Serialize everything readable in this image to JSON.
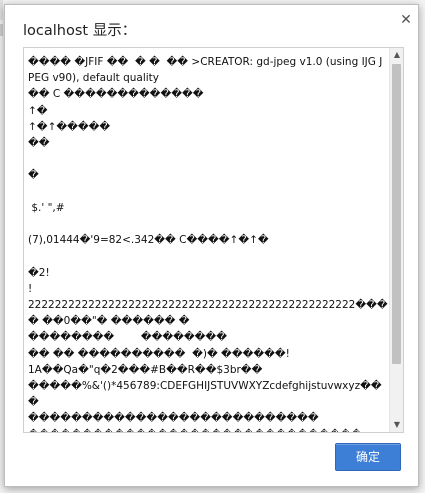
{
  "dialog": {
    "title": "localhost 显示：",
    "close_icon": "close-icon",
    "message": "���� �JFIF ��  � �  �� >CREATOR: gd-jpeg v1.0 (using IJG JPEG v90), default quality\n�� C �������������\n↑�\n↑�↑�����\n��\n\n�\n\n $.' \",#\n\n(7),01444�'9=82<.342�� C����↑�↑�\n\n�2!\n!\n2222222222222222222222222222222222222222222222222��� � ��0��\"� ������ �\n��������        ��������\n�� �� ����������  �)� ������!\n1A��Qa�\"q�2���#B��R��$3br��\n�����%&'()*456789:CDEFGHIJSTUVWXYZcdefghijstuvwxyz���\n���������������������������\n�������������������������������\n���������� �� �����������       ��������\n�� ��� � ����������� w�� �����!",
    "ok_label": "确定"
  }
}
